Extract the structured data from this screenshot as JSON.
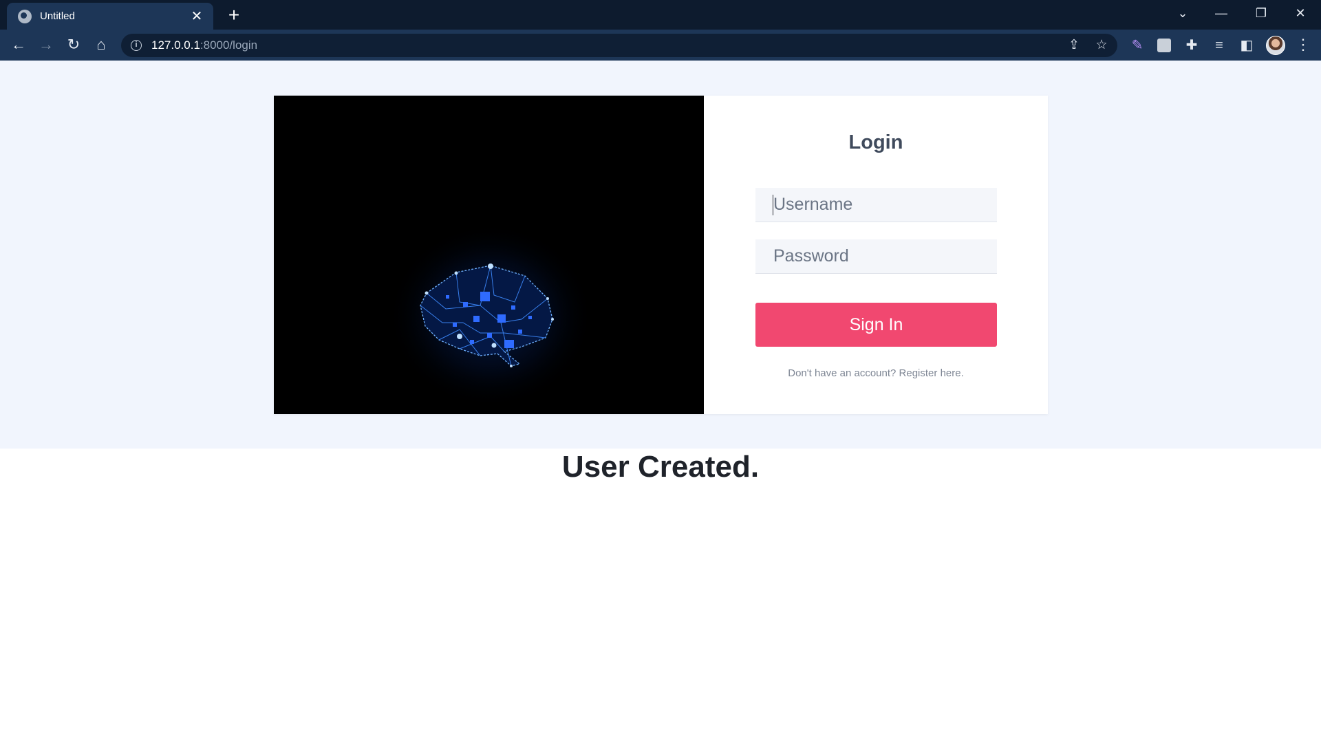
{
  "browser": {
    "tab_title": "Untitled",
    "tab_close": "✕",
    "new_tab": "+",
    "url_host": "127.0.0.1",
    "url_path": ":8000/login",
    "window_controls": {
      "menu": "⌄",
      "minimize": "—",
      "restore": "❐",
      "close": "✕"
    },
    "nav": {
      "back": "←",
      "forward": "→",
      "reload": "↻",
      "home": "⌂",
      "menu": "⋮"
    },
    "icons": [
      "share-icon",
      "bookmark-star-icon",
      "feather-extension-icon",
      "extension-square-icon",
      "puzzle-icon",
      "reading-list-icon",
      "side-panel-icon",
      "profile-avatar"
    ]
  },
  "login": {
    "title": "Login",
    "username_placeholder": "Username",
    "password_placeholder": "Password",
    "signin_label": "Sign In",
    "register_text": "Don't have an account? Register here."
  },
  "message": "User Created.",
  "colors": {
    "tabstrip": "#0d1b2e",
    "toolbar": "#1d3657",
    "hero_bg": "#f1f5fd",
    "accent": "#f14870",
    "brain_glow": "#1e6dff"
  }
}
